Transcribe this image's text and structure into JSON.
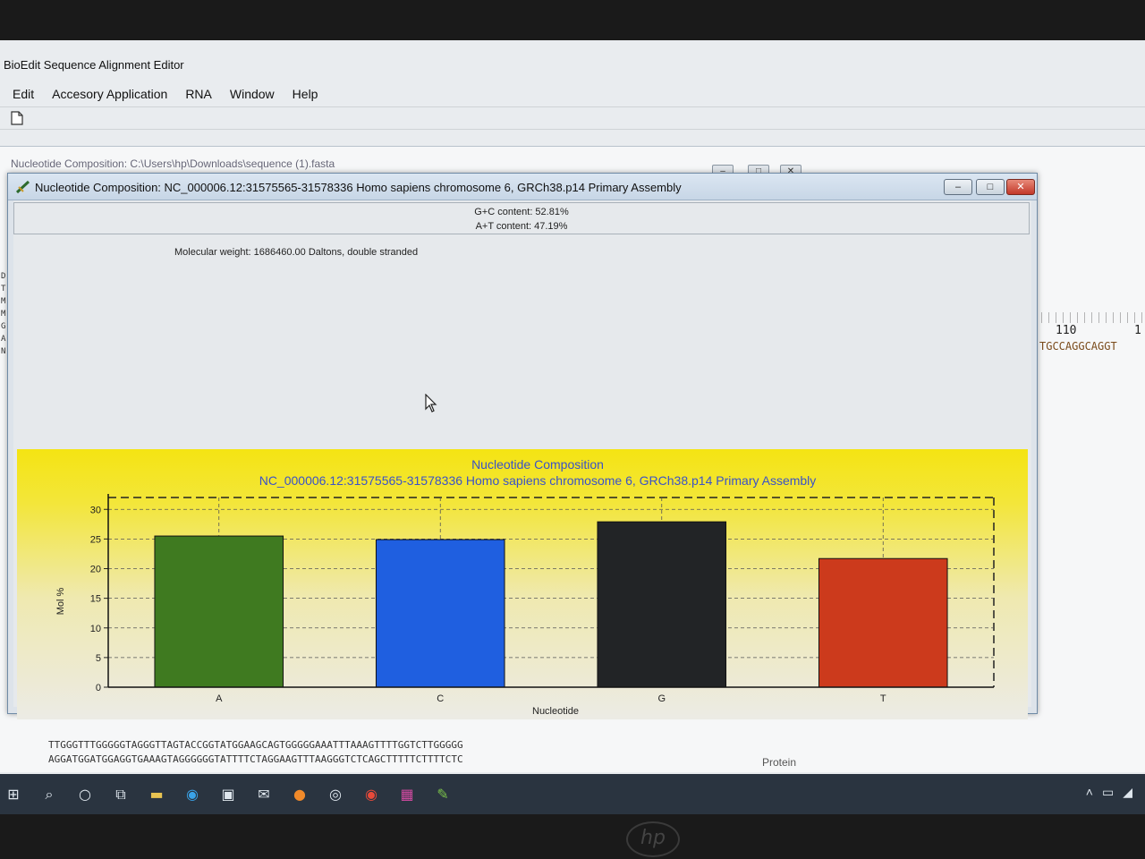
{
  "app": {
    "title": "BioEdit Sequence Alignment Editor",
    "menu": [
      "Edit",
      "Accesory Application",
      "RNA",
      "Window",
      "Help"
    ]
  },
  "back_window": {
    "title": "Nucleotide Composition: C:\\Users\\hp\\Downloads\\sequence (1).fasta",
    "ruler_label": "110",
    "ruler_label_2": "1",
    "sequence_fragment": "TGCCAGGCAGGT"
  },
  "dialog": {
    "title": "Nucleotide Composition: NC_000006.12:31575565-31578336 Homo sapiens chromosome 6, GRCh38.p14 Primary Assembly",
    "gc_content": "G+C content: 52.81%",
    "at_content": "A+T content: 47.19%",
    "molecular_weight": "Molecular weight: 1686460.00 Daltons, double stranded"
  },
  "chart_data": {
    "type": "bar",
    "title": "Nucleotide Composition",
    "subtitle": "NC_000006.12:31575565-31578336 Homo sapiens chromosome 6, GRCh38.p14 Primary Assembly",
    "xlabel": "Nucleotide",
    "ylabel": "Mol %",
    "categories": [
      "A",
      "C",
      "G",
      "T"
    ],
    "values": [
      25.5,
      24.9,
      27.9,
      21.7
    ],
    "colors": [
      "#3f7a20",
      "#1f5fe0",
      "#222426",
      "#cc3a1c"
    ],
    "ylim": [
      0,
      32
    ],
    "yticks": [
      0,
      5,
      10,
      15,
      20,
      25,
      30
    ],
    "grid": true,
    "background": "#f4e413"
  },
  "bottom": {
    "seq_line_1": "TTGGGTTTGGGGGTAGGGTTAGTACCGGTATGGAAGCAGTGGGGGAAATTTAAAGTTTTGGTCTTGGGGG",
    "seq_line_2": "AGGATGGATGGAGGTGAAAGTAGGGGGGTATTTTCTAGGAAGTTTAAGGGTCTCAGCTTTTTCTTTTCTC",
    "protein_label": "Protein"
  },
  "bezel": {
    "logo": "hp"
  }
}
